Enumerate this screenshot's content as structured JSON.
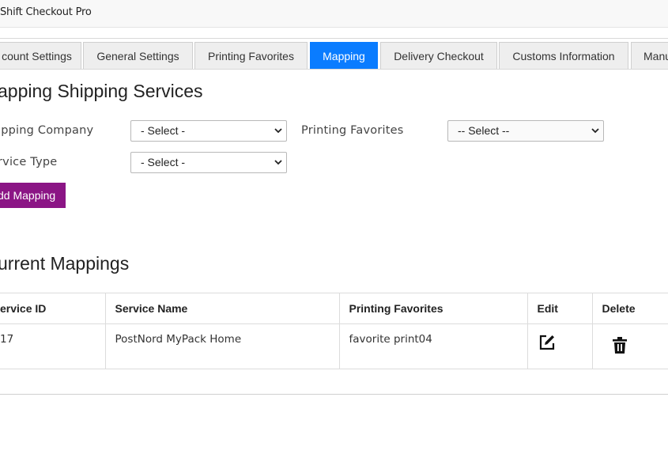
{
  "app": {
    "title": "Shift Checkout Pro"
  },
  "tabs": [
    {
      "label": "count Settings",
      "active": false
    },
    {
      "label": "General Settings",
      "active": false
    },
    {
      "label": "Printing Favorites",
      "active": false
    },
    {
      "label": "Mapping",
      "active": true
    },
    {
      "label": "Delivery Checkout",
      "active": false
    },
    {
      "label": "Customs Information",
      "active": false
    },
    {
      "label": "Manu",
      "active": false
    }
  ],
  "mapping": {
    "heading": "apping Shipping Services",
    "shipping_company_label": "ipping Company",
    "shipping_company_value": "- Select -",
    "printing_favorites_label": "Printing Favorites",
    "printing_favorites_value": "-- Select --",
    "service_type_label": "rvice Type",
    "service_type_value": "- Select -",
    "add_button": "dd Mapping"
  },
  "current": {
    "heading": "urrent Mappings",
    "columns": [
      "ervice ID",
      "Service Name",
      "Printing Favorites",
      "Edit",
      "Delete"
    ],
    "rows": [
      {
        "service_id": "17",
        "service_name": "PostNord MyPack Home",
        "printing_favorites": "favorite print04"
      }
    ]
  },
  "icons": {
    "edit": "edit-icon",
    "delete": "trash-icon",
    "select": "chevron-down-icon"
  },
  "colors": {
    "active_tab": "#0a7cff",
    "add_button": "#8b1585"
  }
}
